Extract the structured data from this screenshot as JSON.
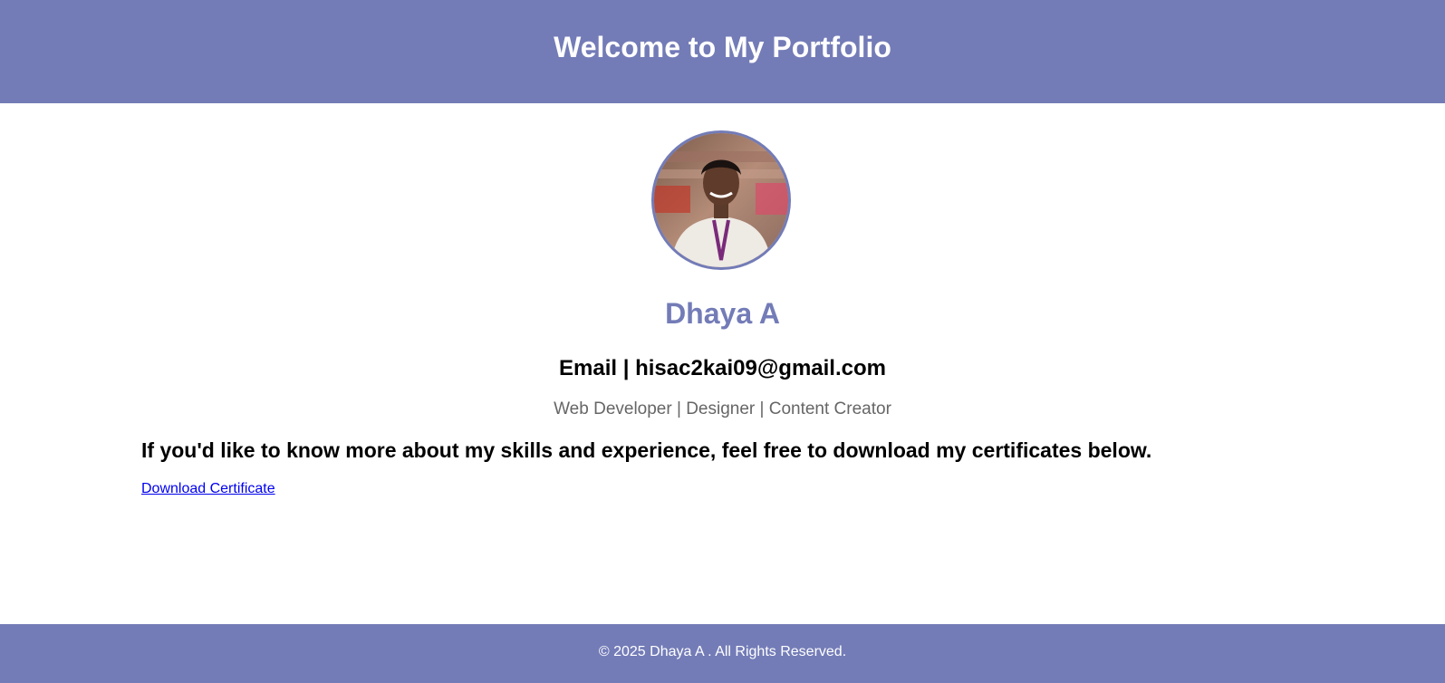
{
  "header": {
    "title": "Welcome to My Portfolio"
  },
  "profile": {
    "avatar_icon": "profile-photo",
    "name": "Dhaya A",
    "email_line": "Email | hisac2kai09@gmail.com",
    "tagline": "Web Developer | Designer | Content Creator"
  },
  "about": {
    "text": "If you'd like to know more about my skills and experience, feel free to download my certificates below.",
    "download_label": "Download Certificate"
  },
  "footer": {
    "text": "© 2025 Dhaya A . All Rights Reserved."
  },
  "colors": {
    "accent": "#737cb7",
    "link": "#0000ee",
    "tagline": "#666666"
  }
}
